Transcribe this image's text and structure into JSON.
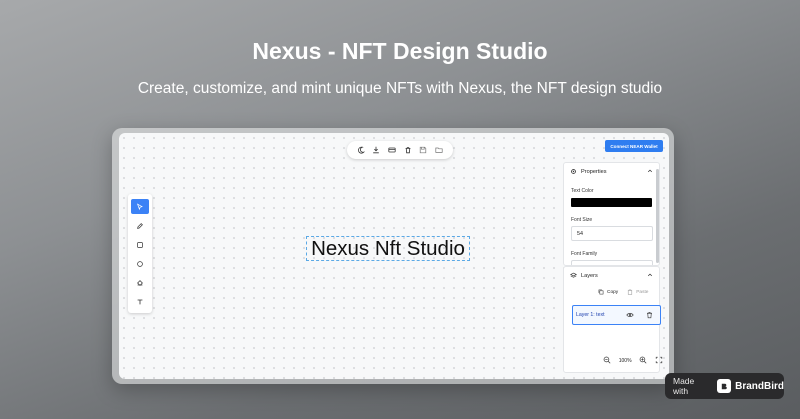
{
  "hero": {
    "title": "Nexus - NFT Design Studio",
    "subtitle": "Create, customize, and mint unique NFTs with Nexus, the NFT design studio"
  },
  "toolbar": {
    "items": [
      "moon-icon",
      "download-icon",
      "card-icon",
      "trash-icon",
      "save-icon",
      "folder-icon"
    ]
  },
  "connect_button": "Connect NEAR Wallet",
  "tools": [
    "pointer-icon",
    "pencil-icon",
    "square-icon",
    "circle-icon",
    "fill-icon",
    "text-icon"
  ],
  "canvas": {
    "text": "Nexus Nft Studio"
  },
  "properties": {
    "title": "Properties",
    "text_color_label": "Text Color",
    "text_color": "#000000",
    "font_size_label": "Font Size",
    "font_size": "54",
    "font_family_label": "Font Family"
  },
  "layers": {
    "title": "Layers",
    "copy": "Copy",
    "paste": "Paste",
    "items": [
      {
        "label": "Layer 1: text"
      }
    ]
  },
  "zoom": {
    "level": "100%"
  },
  "badge": {
    "made_with": "Made with",
    "brand": "BrandBird"
  },
  "colors": {
    "accent": "#2f7df0",
    "badge_bg": "#2a2a2c"
  }
}
